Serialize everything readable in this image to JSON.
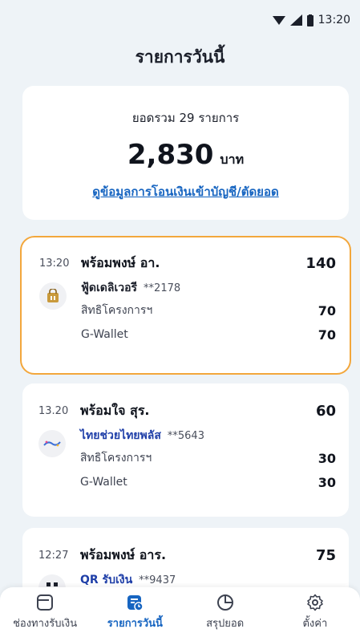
{
  "status": {
    "time": "13:20"
  },
  "header": {
    "title": "รายการวันนี้"
  },
  "summary": {
    "label": "ยอดรวม 29 รายการ",
    "total": "2,830",
    "unit": "บาท",
    "link": "ดูข้อมูลการโอนเงินเข้าบัญชี/ตัดยอด"
  },
  "transactions": [
    {
      "time": "13:20",
      "name": "พร้อมพงษ์ อา.",
      "amount": "140",
      "channel": "ฟู้ดเดลิเวอรี",
      "account": "**2178",
      "logo_icon": "food-delivery-bag-icon",
      "rows": [
        {
          "label": "สิทธิโครงการฯ",
          "value": "70"
        },
        {
          "label": "G-Wallet",
          "value": "70"
        }
      ]
    },
    {
      "time": "13.20",
      "name": "พร้อมใจ สุร.",
      "amount": "60",
      "channel": "ไทยช่วยไทยพลัส",
      "account": "**5643",
      "logo_icon": "thai-chuay-thai-plus-logo-icon",
      "rows": [
        {
          "label": "สิทธิโครงการฯ",
          "value": "30"
        },
        {
          "label": "G-Wallet",
          "value": "30"
        }
      ]
    },
    {
      "time": "12:27",
      "name": "พร้อมพงษ์ อาร.",
      "amount": "75",
      "channel": "QR รับเงิน",
      "account": "**9437",
      "logo_icon": "qr-icon"
    }
  ],
  "nav": {
    "items": [
      {
        "label": "ช่องทางรับเงิน",
        "icon": "wallet-icon"
      },
      {
        "label": "รายการวันนี้",
        "icon": "today-list-icon"
      },
      {
        "label": "สรุปยอด",
        "icon": "pie-chart-icon"
      },
      {
        "label": "ตั้งค่า",
        "icon": "gear-icon"
      }
    ]
  },
  "colors": {
    "accent": "#1765c1",
    "highlight_border": "#f3a73c",
    "background": "#eef3f7"
  }
}
